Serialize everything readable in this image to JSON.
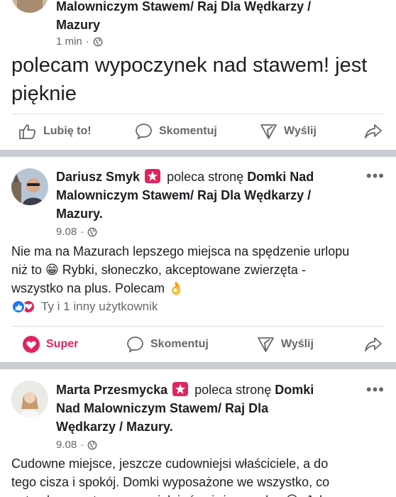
{
  "post1": {
    "page_name_tail": "Malowniczym Stawem/ Raj Dla Wędkarzy /",
    "page_name_line3": "Mazury",
    "time": "1 min",
    "text_line1": "polecam wypoczynek nad stawem! jest",
    "text_line2": "pięknie"
  },
  "post2": {
    "author": "Dariusz Smyk",
    "recommends": "poleca stronę",
    "page_name_l1": "Domki Nad",
    "page_name_l2": "Malowniczym Stawem/ Raj Dla Wędkarzy /",
    "page_name_l3": "Mazury",
    "date": "9.08",
    "text_l1": "Nie ma na Mazurach lepszego miejsca na spędzenie urlopu",
    "text_l2": "niż to 😁 Rybki, słoneczko, akceptowane zwierzęta -",
    "text_l3": "wszystko na plus. Polecam 👌",
    "reaction_summary": "Ty i 1 inny użytkownik"
  },
  "post3": {
    "author": "Marta Przesmycka",
    "recommends": "poleca stronę",
    "page_name_l1a": "Domki",
    "page_name_l2": "Nad Malowniczym Stawem/ Raj Dla",
    "page_name_l3": "Wędkarzy / Mazury",
    "date": "9.08",
    "text_l1": "Cudowne miejsce, jeszcze cudowniejsi właściciele, a do",
    "text_l2": "tego cisza i spokój. Domki wyposażone we wszystko, co",
    "text_l3": "potrzebne, materac w sypialni również wygodny 😀. Jak"
  },
  "actions": {
    "like": "Lubię to!",
    "super": "Super",
    "comment": "Skomentuj",
    "send": "Wyślij"
  },
  "menu_dots": "•••",
  "colors": {
    "accent_red": "#e0245e",
    "fb_blue": "#1877f2",
    "muted": "#65676b",
    "separator": "#c9ccd1"
  }
}
